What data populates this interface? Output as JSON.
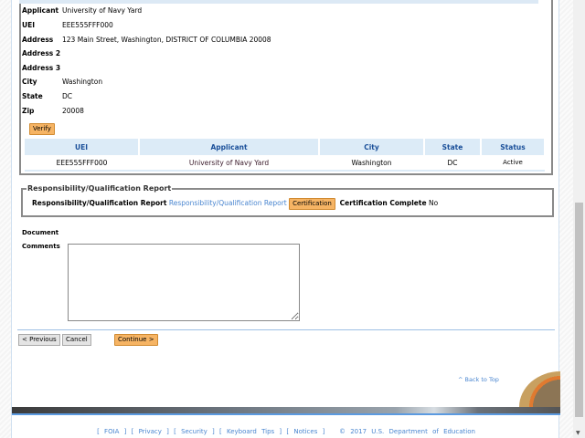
{
  "applicant_details": [
    {
      "label": "Applicant",
      "value": "University of Navy Yard"
    },
    {
      "label": "UEI",
      "value": "EEE555FFF000"
    },
    {
      "label": "Address",
      "value": "123 Main Street, Washington, DISTRICT OF COLUMBIA 20008"
    },
    {
      "label": "Address 2",
      "value": ""
    },
    {
      "label": "Address 3",
      "value": ""
    },
    {
      "label": "City",
      "value": "Washington"
    },
    {
      "label": "State",
      "value": "DC"
    },
    {
      "label": "Zip",
      "value": "20008"
    }
  ],
  "verify_label": "Verify",
  "table": {
    "headers": [
      "UEI",
      "Applicant",
      "City",
      "State",
      "Status"
    ],
    "rows": [
      [
        "EEE555FFF000",
        "University of Navy Yard",
        "Washington",
        "DC",
        "Active"
      ]
    ]
  },
  "rq": {
    "legend": "Responsibility/Qualification Report",
    "label": "Responsibility/Qualification Report",
    "link": "Responsibility/Qualification Report",
    "cert_button": "Certification",
    "complete_label": "Certification Complete",
    "complete_value": "No"
  },
  "document_label": "Document",
  "comments_label": "Comments",
  "comments_value": "",
  "nav": {
    "previous": "< Previous",
    "cancel": "Cancel",
    "continue": "Continue >"
  },
  "back_to_top": "^ Back to Top",
  "footer": {
    "links": [
      "FOIA",
      "Privacy",
      "Security",
      "Keyboard Tips",
      "Notices"
    ],
    "copyright": "© 2017 U.S. Department of Education"
  },
  "colors": {
    "accent_button": "#f6b464",
    "link": "#4a86d0",
    "table_header_bg": "#dcebf7"
  }
}
